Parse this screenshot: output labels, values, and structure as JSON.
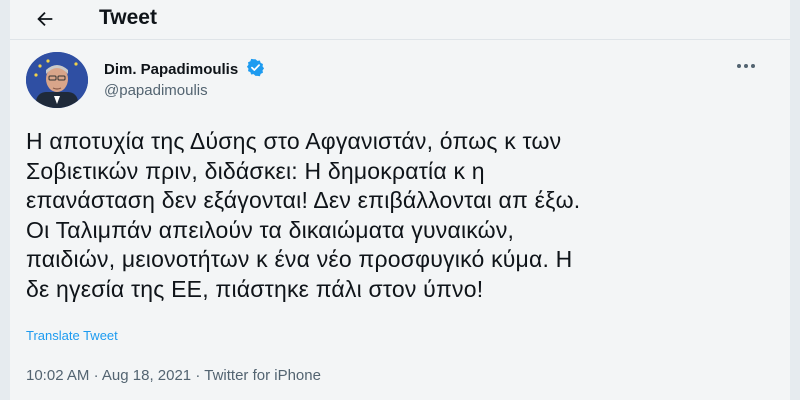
{
  "header": {
    "title": "Tweet"
  },
  "author": {
    "name": "Dim. Papadimoulis",
    "handle": "@papadimoulis"
  },
  "tweet": {
    "text": "Η αποτυχία της Δύσης στο Αφγανιστάν, όπως κ των\nΣοβιετικών πριν, διδάσκει: Η δημοκρατία κ η\nεπανάσταση δεν εξάγονται! Δεν επιβάλλονται απ έξω.\nΟι Ταλιμπάν απειλούν τα δικαιώματα γυναικών,\nπαιδιών, μειονοτήτων κ ένα νέο προσφυγικό κύμα. Η\nδε ηγεσία της ΕΕ, πιάστηκε πάλι στον ύπνο!",
    "translate_label": "Translate Tweet",
    "time": "10:02 AM",
    "date": "Aug 18, 2021",
    "source": "Twitter for iPhone",
    "separator": "·"
  },
  "colors": {
    "accent": "#1d9bf0",
    "text": "#0f1419",
    "secondary": "#536471"
  },
  "icons": {
    "back": "arrow-left-icon",
    "verified": "verified-badge-icon",
    "more": "more-dots-icon"
  }
}
